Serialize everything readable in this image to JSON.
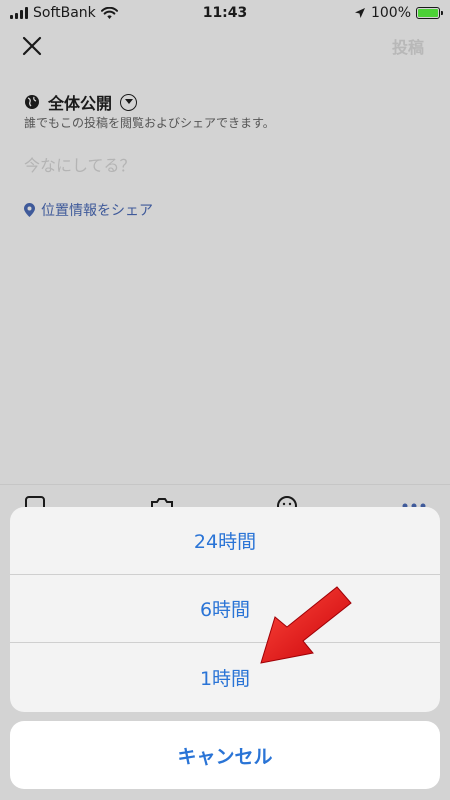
{
  "status_bar": {
    "carrier": "SoftBank",
    "time": "11:43",
    "battery": "100%"
  },
  "header": {
    "close_icon": "close-icon",
    "post_label": "投稿"
  },
  "audience": {
    "icon": "globe-icon",
    "label": "全体公開",
    "description": "誰でもこの投稿を閲覧およびシェアできます。"
  },
  "compose": {
    "placeholder": "今なにしてる？"
  },
  "location": {
    "icon": "location-pin-icon",
    "label": "位置情報をシェア"
  },
  "action_sheet": {
    "options": [
      {
        "label": "24時間"
      },
      {
        "label": "6時間"
      },
      {
        "label": "1時間"
      }
    ],
    "cancel_label": "キャンセル"
  },
  "colors": {
    "accent": "#2a74d6",
    "arrow": "#e8000b"
  }
}
